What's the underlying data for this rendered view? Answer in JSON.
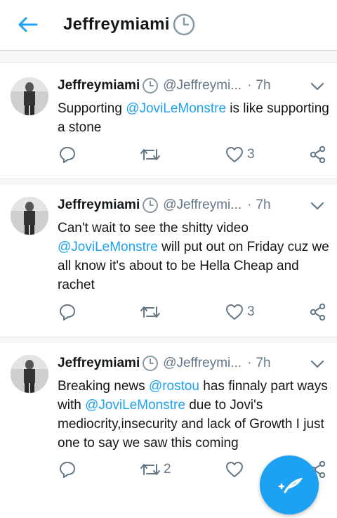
{
  "header": {
    "title": "Jeffreymiami",
    "title_icon": "clock-emoji",
    "back_icon": "back-arrow-icon"
  },
  "tweets": [
    {
      "name": "Jeffreymiami",
      "handle": "@Jeffreymi...",
      "time": "7h",
      "text_parts": [
        {
          "t": "Supporting ",
          "mention": false
        },
        {
          "t": "@JoviLeMonstre",
          "mention": true
        },
        {
          "t": " is like supporting a stone",
          "mention": false
        }
      ],
      "reply_count": "",
      "retweet_count": "",
      "like_count": "3"
    },
    {
      "name": "Jeffreymiami",
      "handle": "@Jeffreymi...",
      "time": "7h",
      "text_parts": [
        {
          "t": "Can't wait to see the shitty video ",
          "mention": false
        },
        {
          "t": "@JoviLeMonstre",
          "mention": true
        },
        {
          "t": " will put out on Friday cuz we all know it's about to be Hella Cheap and rachet",
          "mention": false
        }
      ],
      "reply_count": "",
      "retweet_count": "",
      "like_count": "3"
    },
    {
      "name": "Jeffreymiami",
      "handle": "@Jeffreymi...",
      "time": "7h",
      "text_parts": [
        {
          "t": "Breaking news ",
          "mention": false
        },
        {
          "t": "@rostou",
          "mention": true
        },
        {
          "t": " has finnaly part ways with ",
          "mention": false
        },
        {
          "t": "@JoviLeMonstre",
          "mention": true
        },
        {
          "t": " due to Jovi's mediocrity,insecurity and lack of Growth I just one to say we saw this coming",
          "mention": false
        }
      ],
      "reply_count": "",
      "retweet_count": "2",
      "like_count": ""
    }
  ],
  "colors": {
    "accent": "#1da1f2",
    "muted": "#657786",
    "text": "#14171a"
  }
}
